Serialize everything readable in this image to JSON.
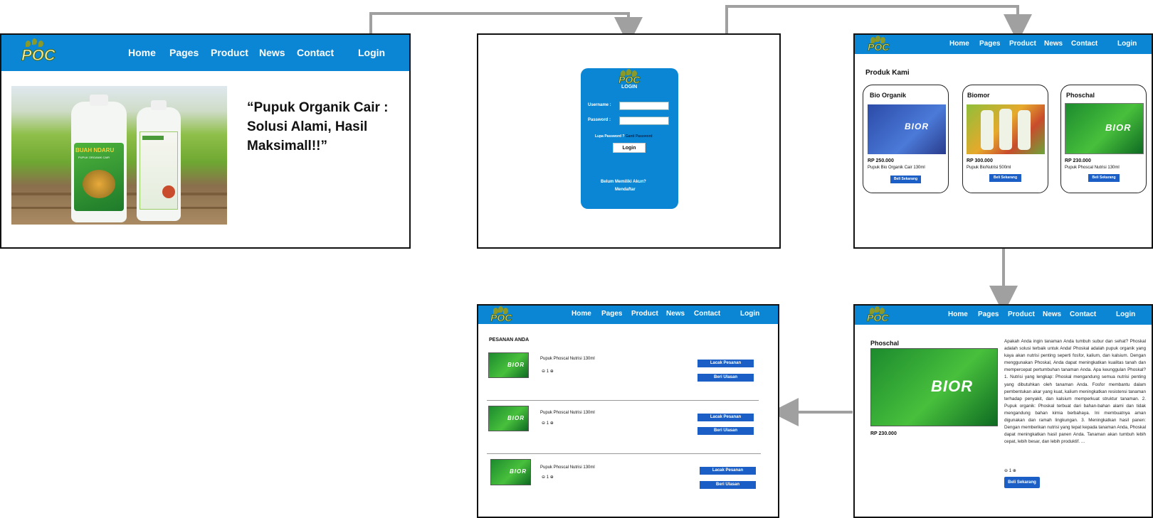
{
  "nav": {
    "logo_text": "POC",
    "home": "Home",
    "pages": "Pages",
    "product": "Product",
    "news": "News",
    "contact": "Contact",
    "login": "Login"
  },
  "home_screen": {
    "tagline_line1": "“Pupuk Organik Cair :",
    "tagline_line2": "Solusi Alami, Hasil",
    "tagline_line3": "Maksimall!!”",
    "bottle_brand": "BUAH NDARU",
    "bottle_sub": "PUPUK ORGANIK CAIR"
  },
  "login_screen": {
    "title": "LOGIN",
    "username_label": "Username :",
    "password_label": "Password :",
    "forgot_text": "Lupa Password ?",
    "change_password": "Ganti Password",
    "login_button": "Login",
    "no_account": "Belum Memiliki Akun?",
    "register": "Mendaftar"
  },
  "products_screen": {
    "heading": "Produk Kami",
    "products": [
      {
        "name": "Bio Organik",
        "price": "RP 250.000",
        "desc": "Pupuk Bio Organik Cair 130ml",
        "button": "Beli Sekarang"
      },
      {
        "name": "Biomor",
        "price": "RP 300.000",
        "desc": "Pupuk BioNutrisi 500ml",
        "button": "Beli Sekarang"
      },
      {
        "name": "Phoschal",
        "price": "RP 230.000",
        "desc": "Pupuk Phoscal Nutrisi 130ml",
        "button": "Beli Sekarang"
      }
    ],
    "box_label": "BIOR"
  },
  "detail_screen": {
    "name": "Phoschal",
    "price": "RP 230.000",
    "description": "Apakah Anda ingin tanaman Anda tumbuh subur dan sehat? Phoskal adalah solusi terbaik untuk Anda! Phoskal adalah pupuk organik yang kaya akan nutrisi penting seperti fosfor, kalium, dan kalsium. Dengan menggunakan Phoskal, Anda dapat meningkatkan kualitas tanah dan mempercepat pertumbuhan tanaman Anda. Apa keunggulan Phoskal? 1. Nutrisi yang lengkap: Phoskal mengandung semua nutrisi penting yang dibutuhkan oleh tanaman Anda. Fosfor membantu dalam pembentukan akar yang kuat, kalium meningkatkan resistensi tanaman terhadap penyakit, dan kalsium memperkuat struktur tanaman. 2. Pupuk organik: Phoskal terbuat dari bahan-bahan alami dan tidak mengandung bahan kimia berbahaya. Ini membuatnya aman digunakan dan ramah lingkungan. 3. Meningkatkan hasil panen: Dengan memberikan nutrisi yang tepat kepada tanaman Anda, Phoskal dapat meningkatkan hasil panen Anda. Tanaman akan tumbuh lebih cepat, lebih besar, dan lebih produktif. ...",
    "qty": "⊖ 1 ⊕",
    "button": "Beli Sekarang",
    "box_label": "BIOR"
  },
  "orders_screen": {
    "heading": "PESANAN ANDA",
    "orders": [
      {
        "name": "Pupuk Phoscal Nutrisi 130ml",
        "qty": "⊖ 1 ⊕",
        "track": "Lacak Pesanan",
        "review": "Beri Ulasan"
      },
      {
        "name": "Pupuk Phoscal Nutrisi 130ml",
        "qty": "⊖ 1 ⊕",
        "track": "Lacak Pesanan",
        "review": "Beri Ulasan"
      },
      {
        "name": "Pupuk Phoscal Nutrisi 130ml",
        "qty": "⊖ 1 ⊕",
        "track": "Lacak Pesanan",
        "review": "Beri Ulasan"
      }
    ],
    "box_label": "BIOR"
  },
  "colors": {
    "nav_blue": "#0a86d4",
    "button_blue": "#1b5fc6",
    "arrow_gray": "#a0a0a0"
  }
}
